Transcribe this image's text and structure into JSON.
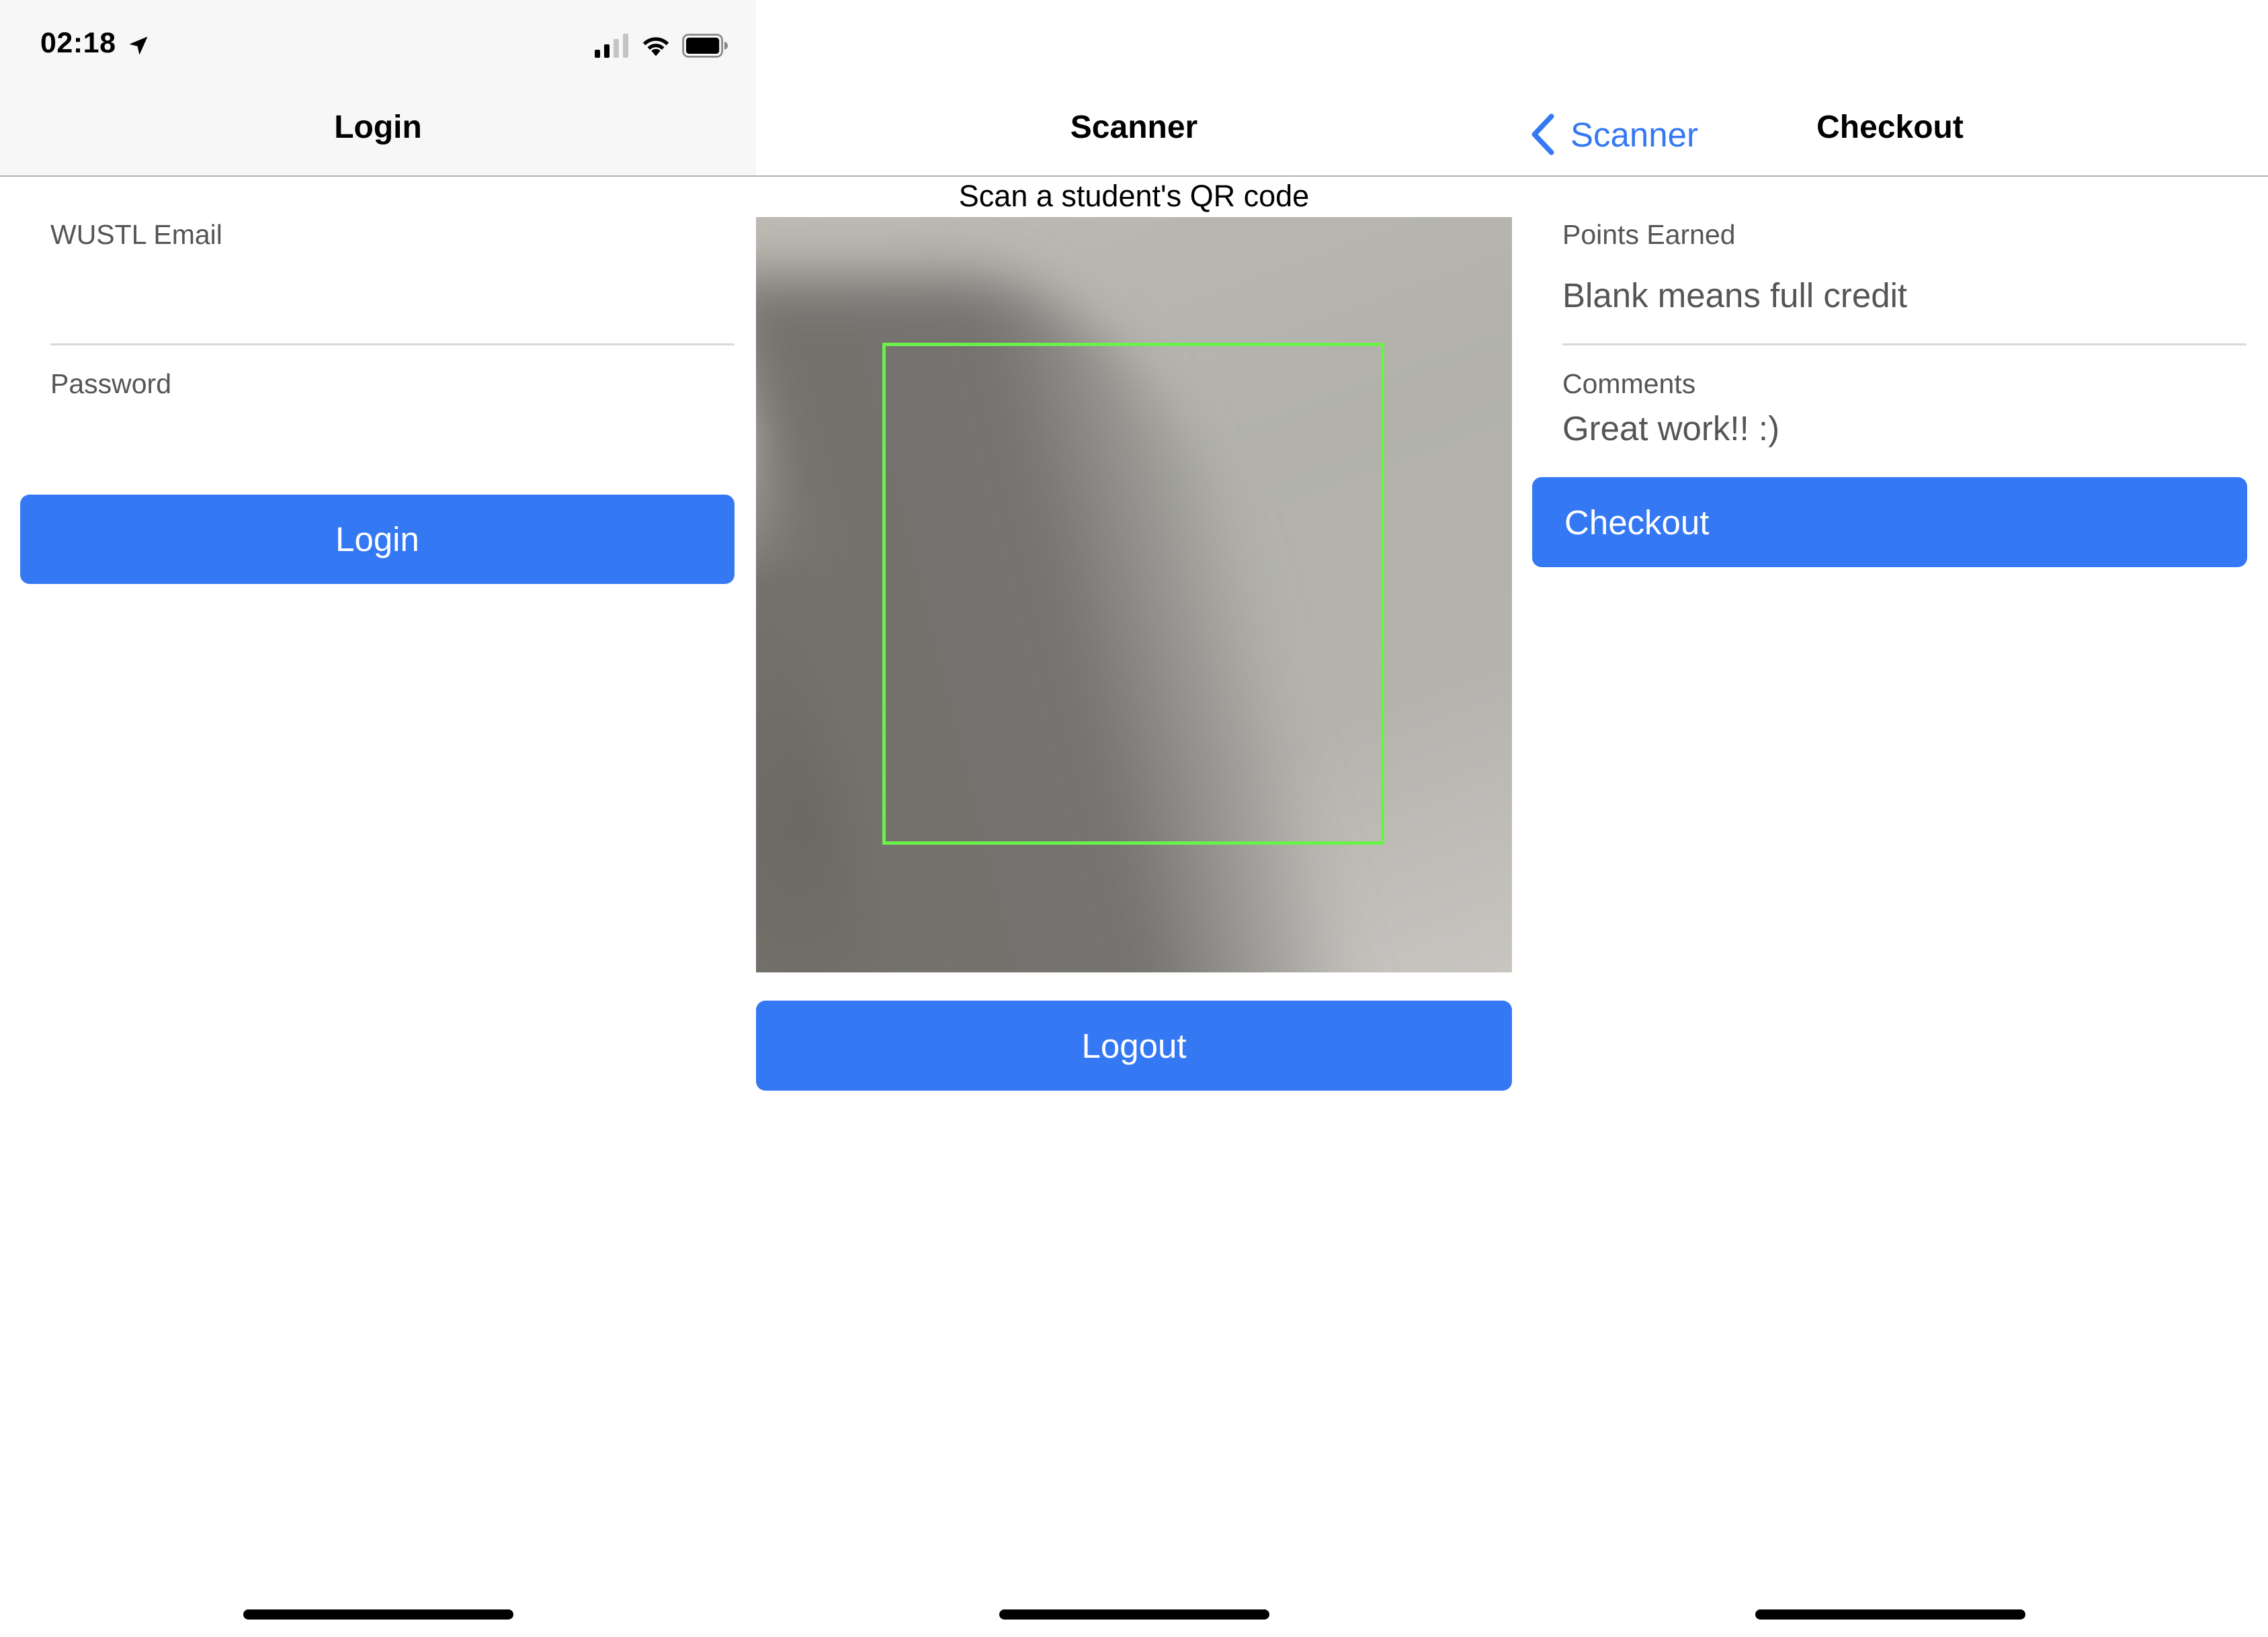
{
  "status_bar": {
    "time": "02:18",
    "location_icon": "location-arrow-icon",
    "signal_icon": "cellular-signal-icon",
    "wifi_icon": "wifi-icon",
    "battery_icon": "battery-icon"
  },
  "login_screen": {
    "title": "Login",
    "fields": [
      {
        "label": "WUSTL Email",
        "value": "",
        "placeholder": ""
      },
      {
        "label": "Password",
        "value": "",
        "placeholder": ""
      }
    ],
    "login_button": "Login"
  },
  "scanner_screen": {
    "title": "Scanner",
    "caption": "Scan a student's QR code",
    "logout_button": "Logout"
  },
  "checkout_screen": {
    "title": "Checkout",
    "back_label": "Scanner",
    "fields": [
      {
        "label": "Points Earned",
        "value": "",
        "placeholder": "Blank means full credit"
      },
      {
        "label": "Comments",
        "value": "Great work!! :)",
        "placeholder": ""
      }
    ],
    "checkout_button": "Checkout"
  },
  "colors": {
    "accent": "#3578f4",
    "scan_frame": "#6af24a",
    "label_text": "#555555",
    "nav_background": "#f7f7f7"
  }
}
